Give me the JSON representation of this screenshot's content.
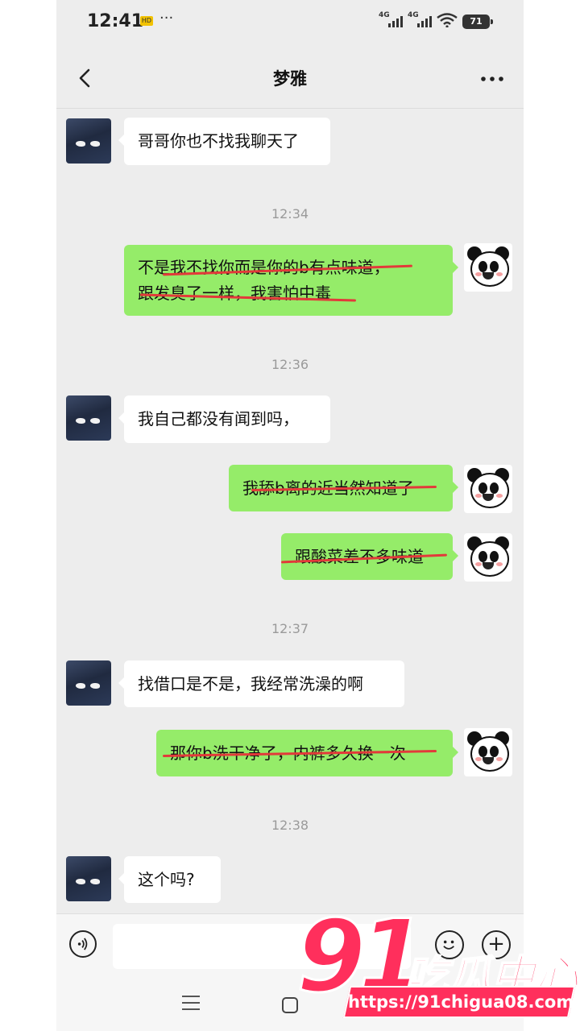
{
  "status_bar": {
    "time": "12:41",
    "sim_badge": "HD",
    "dots": "···",
    "signal1": "4G",
    "signal2": "4G",
    "battery": "71"
  },
  "header": {
    "title": "梦雅"
  },
  "timestamps": [
    "12:34",
    "12:36",
    "12:37",
    "12:38"
  ],
  "messages": [
    {
      "side": "left",
      "text": "哥哥你也不找我聊天了"
    },
    {
      "side": "right",
      "lines": [
        "不是我不找你而是你的b有点味道，",
        "跟发臭了一样，我害怕中毒"
      ]
    },
    {
      "side": "left",
      "text": "我自己都没有闻到吗，"
    },
    {
      "side": "right",
      "text": "我舔b离的近当然知道了"
    },
    {
      "side": "right",
      "text": "跟酸菜差不多味道"
    },
    {
      "side": "left",
      "text": "找借口是不是，我经常洗澡的啊"
    },
    {
      "side": "right",
      "text": "那你b洗干净了，内裤多久换一次"
    },
    {
      "side": "left",
      "text": "这个吗?"
    }
  ],
  "watermark": {
    "number": "91",
    "name": "吃瓜中心",
    "url": "https://91chigua08.com"
  },
  "icons": {
    "back": "chevron-left-icon",
    "more": "more-dots-icon",
    "voice": "voice-icon",
    "emoji": "emoji-icon",
    "plus": "plus-icon"
  }
}
